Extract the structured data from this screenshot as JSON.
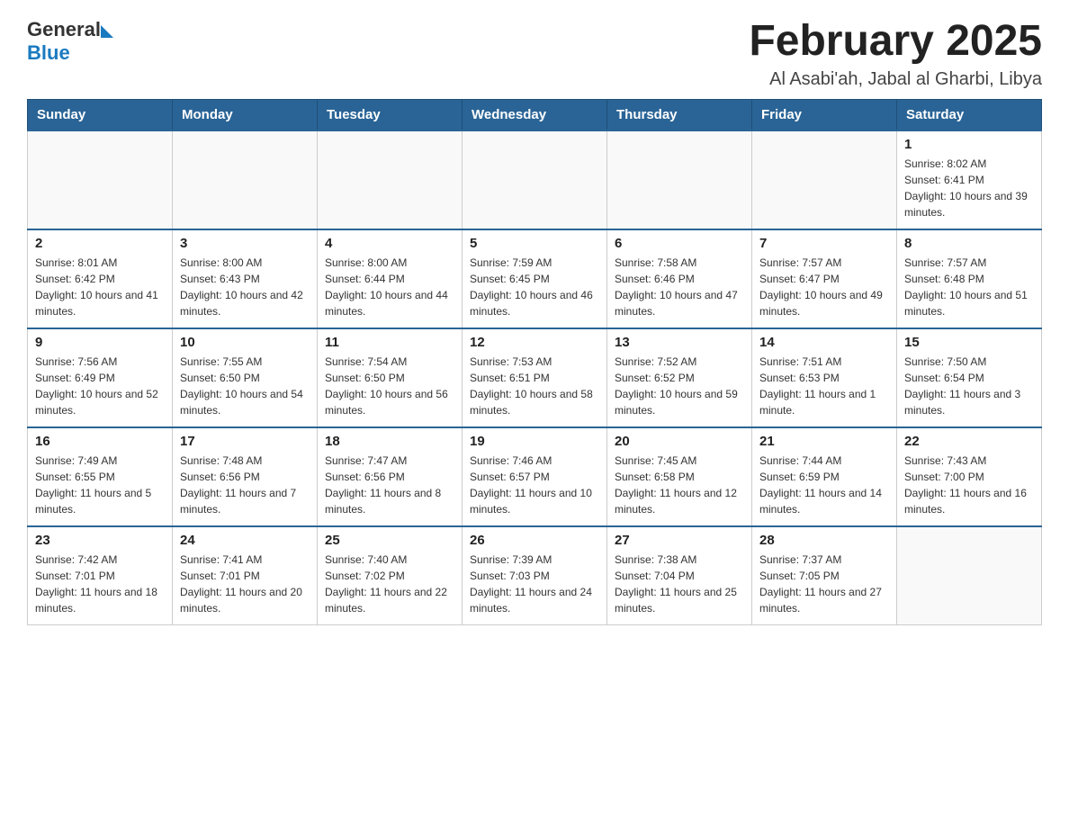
{
  "header": {
    "logo": {
      "general": "General",
      "blue": "Blue"
    },
    "title": "February 2025",
    "location": "Al Asabi'ah, Jabal al Gharbi, Libya"
  },
  "days_of_week": [
    "Sunday",
    "Monday",
    "Tuesday",
    "Wednesday",
    "Thursday",
    "Friday",
    "Saturday"
  ],
  "weeks": [
    [
      {
        "day": "",
        "info": ""
      },
      {
        "day": "",
        "info": ""
      },
      {
        "day": "",
        "info": ""
      },
      {
        "day": "",
        "info": ""
      },
      {
        "day": "",
        "info": ""
      },
      {
        "day": "",
        "info": ""
      },
      {
        "day": "1",
        "info": "Sunrise: 8:02 AM\nSunset: 6:41 PM\nDaylight: 10 hours and 39 minutes."
      }
    ],
    [
      {
        "day": "2",
        "info": "Sunrise: 8:01 AM\nSunset: 6:42 PM\nDaylight: 10 hours and 41 minutes."
      },
      {
        "day": "3",
        "info": "Sunrise: 8:00 AM\nSunset: 6:43 PM\nDaylight: 10 hours and 42 minutes."
      },
      {
        "day": "4",
        "info": "Sunrise: 8:00 AM\nSunset: 6:44 PM\nDaylight: 10 hours and 44 minutes."
      },
      {
        "day": "5",
        "info": "Sunrise: 7:59 AM\nSunset: 6:45 PM\nDaylight: 10 hours and 46 minutes."
      },
      {
        "day": "6",
        "info": "Sunrise: 7:58 AM\nSunset: 6:46 PM\nDaylight: 10 hours and 47 minutes."
      },
      {
        "day": "7",
        "info": "Sunrise: 7:57 AM\nSunset: 6:47 PM\nDaylight: 10 hours and 49 minutes."
      },
      {
        "day": "8",
        "info": "Sunrise: 7:57 AM\nSunset: 6:48 PM\nDaylight: 10 hours and 51 minutes."
      }
    ],
    [
      {
        "day": "9",
        "info": "Sunrise: 7:56 AM\nSunset: 6:49 PM\nDaylight: 10 hours and 52 minutes."
      },
      {
        "day": "10",
        "info": "Sunrise: 7:55 AM\nSunset: 6:50 PM\nDaylight: 10 hours and 54 minutes."
      },
      {
        "day": "11",
        "info": "Sunrise: 7:54 AM\nSunset: 6:50 PM\nDaylight: 10 hours and 56 minutes."
      },
      {
        "day": "12",
        "info": "Sunrise: 7:53 AM\nSunset: 6:51 PM\nDaylight: 10 hours and 58 minutes."
      },
      {
        "day": "13",
        "info": "Sunrise: 7:52 AM\nSunset: 6:52 PM\nDaylight: 10 hours and 59 minutes."
      },
      {
        "day": "14",
        "info": "Sunrise: 7:51 AM\nSunset: 6:53 PM\nDaylight: 11 hours and 1 minute."
      },
      {
        "day": "15",
        "info": "Sunrise: 7:50 AM\nSunset: 6:54 PM\nDaylight: 11 hours and 3 minutes."
      }
    ],
    [
      {
        "day": "16",
        "info": "Sunrise: 7:49 AM\nSunset: 6:55 PM\nDaylight: 11 hours and 5 minutes."
      },
      {
        "day": "17",
        "info": "Sunrise: 7:48 AM\nSunset: 6:56 PM\nDaylight: 11 hours and 7 minutes."
      },
      {
        "day": "18",
        "info": "Sunrise: 7:47 AM\nSunset: 6:56 PM\nDaylight: 11 hours and 8 minutes."
      },
      {
        "day": "19",
        "info": "Sunrise: 7:46 AM\nSunset: 6:57 PM\nDaylight: 11 hours and 10 minutes."
      },
      {
        "day": "20",
        "info": "Sunrise: 7:45 AM\nSunset: 6:58 PM\nDaylight: 11 hours and 12 minutes."
      },
      {
        "day": "21",
        "info": "Sunrise: 7:44 AM\nSunset: 6:59 PM\nDaylight: 11 hours and 14 minutes."
      },
      {
        "day": "22",
        "info": "Sunrise: 7:43 AM\nSunset: 7:00 PM\nDaylight: 11 hours and 16 minutes."
      }
    ],
    [
      {
        "day": "23",
        "info": "Sunrise: 7:42 AM\nSunset: 7:01 PM\nDaylight: 11 hours and 18 minutes."
      },
      {
        "day": "24",
        "info": "Sunrise: 7:41 AM\nSunset: 7:01 PM\nDaylight: 11 hours and 20 minutes."
      },
      {
        "day": "25",
        "info": "Sunrise: 7:40 AM\nSunset: 7:02 PM\nDaylight: 11 hours and 22 minutes."
      },
      {
        "day": "26",
        "info": "Sunrise: 7:39 AM\nSunset: 7:03 PM\nDaylight: 11 hours and 24 minutes."
      },
      {
        "day": "27",
        "info": "Sunrise: 7:38 AM\nSunset: 7:04 PM\nDaylight: 11 hours and 25 minutes."
      },
      {
        "day": "28",
        "info": "Sunrise: 7:37 AM\nSunset: 7:05 PM\nDaylight: 11 hours and 27 minutes."
      },
      {
        "day": "",
        "info": ""
      }
    ]
  ]
}
